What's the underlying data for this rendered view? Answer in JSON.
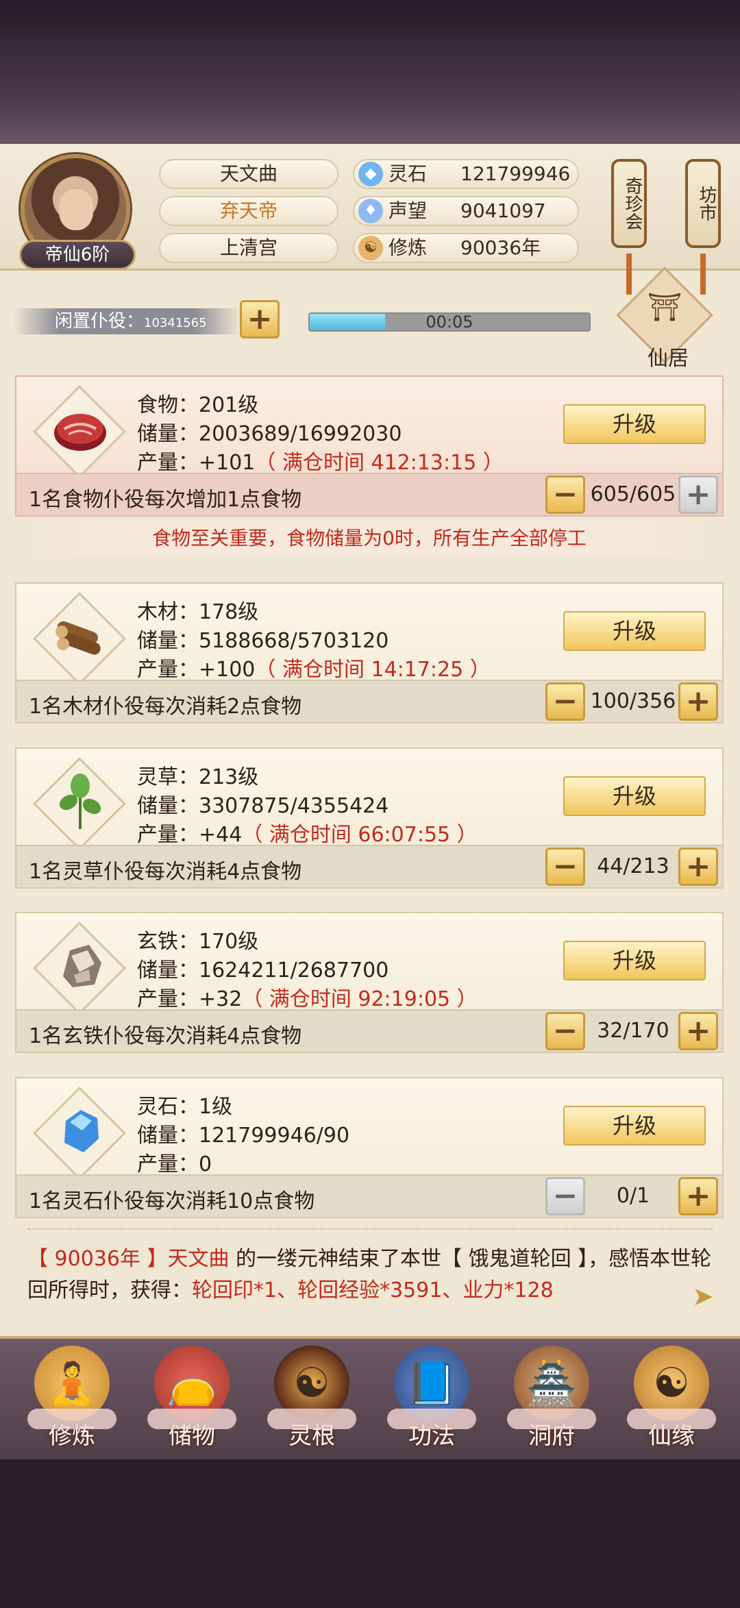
{
  "profile": {
    "rank": "帝仙6阶",
    "names": [
      "天文曲",
      "弃天帝",
      "上清宫"
    ]
  },
  "stats": [
    {
      "icon": "spirit-stone-icon",
      "label": "灵石",
      "value": "121799946"
    },
    {
      "icon": "reputation-icon",
      "label": "声望",
      "value": "9041097"
    },
    {
      "icon": "cultivation-icon",
      "label": "修炼",
      "value": "90036年"
    }
  ],
  "top_buttons": {
    "treasure": "奇珍会",
    "market": "坊市"
  },
  "idle": {
    "label": "闲置仆役：",
    "count": "10341565",
    "timer": "00:05",
    "progress_fraction": 0.27
  },
  "residence_label": "仙居",
  "resources": [
    {
      "icon": "meat-icon",
      "name": "食物：201级",
      "storage": "储量：2003689/16992030",
      "yield_prefix": "产量：+101",
      "full_time": "（ 满仓时间 412:13:15 ）",
      "upgrade": "升级",
      "worker_text": "1名食物仆役每次增加1点食物",
      "worker_count": "605/605"
    },
    {
      "icon": "wood-icon",
      "name": "木材：178级",
      "storage": "储量：5188668/5703120",
      "yield_prefix": "产量：+100",
      "full_time": "（ 满仓时间 14:17:25 ）",
      "upgrade": "升级",
      "worker_text": "1名木材仆役每次消耗2点食物",
      "worker_count": "100/356"
    },
    {
      "icon": "herb-icon",
      "name": "灵草：213级",
      "storage": "储量：3307875/4355424",
      "yield_prefix": "产量：+44",
      "full_time": "（ 满仓时间 66:07:55 ）",
      "upgrade": "升级",
      "worker_text": "1名灵草仆役每次消耗4点食物",
      "worker_count": "44/213"
    },
    {
      "icon": "iron-ore-icon",
      "name": "玄铁：170级",
      "storage": "储量：1624211/2687700",
      "yield_prefix": "产量：+32",
      "full_time": "（ 满仓时间 92:19:05 ）",
      "upgrade": "升级",
      "worker_text": "1名玄铁仆役每次消耗4点食物",
      "worker_count": "32/170"
    },
    {
      "icon": "crystal-icon",
      "name": "灵石：1级",
      "storage": "储量：121799946/90",
      "yield_prefix": "产量：0",
      "full_time": "",
      "upgrade": "升级",
      "worker_text": "1名灵石仆役每次消耗10点食物",
      "worker_count": "0/1"
    }
  ],
  "warning": "食物至关重要，食物储量为0时，所有生产全部停工",
  "log": {
    "year": "【 90036年 】",
    "name": "天文曲",
    "text1": " 的一缕元神结束了本世【 饿鬼道轮回 】，感悟本世轮回所得时，获得：",
    "rewards": "轮回印*1、轮回经验*3591、业力*128"
  },
  "nav": [
    {
      "icon": "cultivate-icon",
      "label": "修炼"
    },
    {
      "icon": "storage-bag-icon",
      "label": "储物"
    },
    {
      "icon": "spirit-root-icon",
      "label": "灵根"
    },
    {
      "icon": "technique-book-icon",
      "label": "功法"
    },
    {
      "icon": "cave-dwelling-icon",
      "label": "洞府"
    },
    {
      "icon": "immortal-fate-icon",
      "label": "仙缘"
    }
  ],
  "colors": {
    "accent_gold": "#f0c65c",
    "warning_red": "#c22a1c",
    "progress_blue": "#52b7df"
  }
}
